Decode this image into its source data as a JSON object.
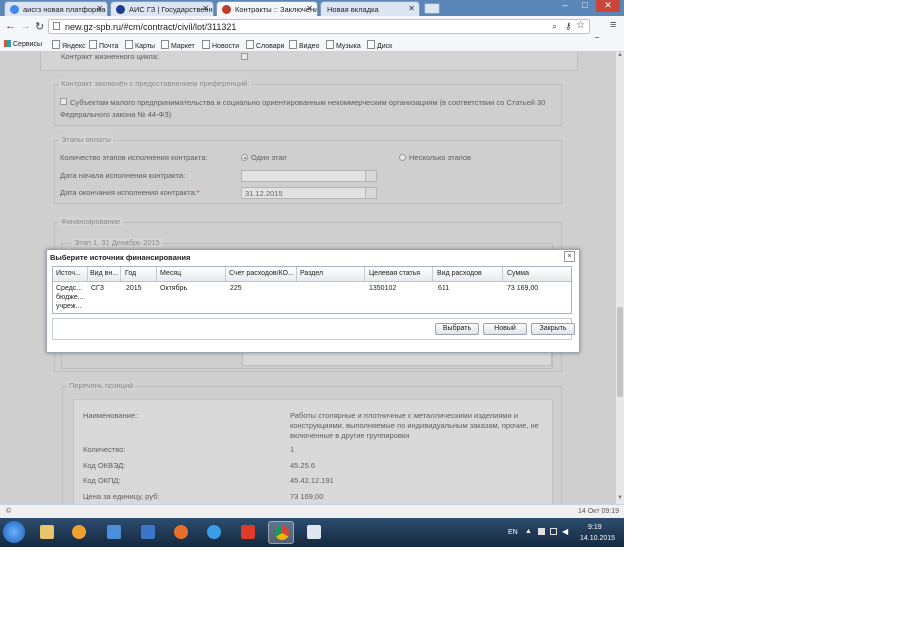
{
  "browser": {
    "tabs": [
      {
        "label": "аисгз новая платформа",
        "color": "#4285f4"
      },
      {
        "label": "АИС ГЗ | Государственн",
        "color": "#1c3c8c"
      },
      {
        "label": "Контракты :: Заключени",
        "color": "#c0392b"
      },
      {
        "label": "Новая вкладка",
        "color": "#cccccc"
      }
    ],
    "url": "new.gz-spb.ru/#cm/contract/civil/lot/311321",
    "bookmarks": [
      "Сервисы",
      "Яндекс",
      "Почта",
      "Карты",
      "Маркет",
      "Новости",
      "Словари",
      "Видео",
      "Музыка",
      "Диск"
    ],
    "status_left": "©",
    "status_right": "14 Окт 09:19"
  },
  "form": {
    "lifecycle_label": "Контракт жизненного цикла:",
    "preferences": {
      "legend": "Контракт заключён с предоставлением преференций:",
      "checkbox_line1": "Субъектам малого предпринимательства и социально ориентированным некоммерческим организациям (в соответствии со Статьей 30",
      "checkbox_line2": "Федерального закона № 44-ФЗ)"
    },
    "payment": {
      "legend": "Этапы оплаты",
      "stages_label": "Количество этапов исполнения контракта:",
      "option_one": "Один этап",
      "option_many": "Несколько этапов",
      "start_label": "Дата начала исполнения контракта:",
      "end_label": "Дата окончания исполнения контракта:",
      "required_mark": "*",
      "end_value": "31.12.2015"
    },
    "financing": {
      "legend": "Финансирование",
      "stage_legend": "Этап 1. 31 Декабрь 2015"
    },
    "positions": {
      "legend": "Перечень позиций",
      "name_label": "Наименование:",
      "name_line1": "Работы столярные и плотничные с металлическими изделиями и",
      "name_line2": "конструкциями, выполняемые по индивидуальным заказам, прочие, не",
      "name_line3": "включенные в другие группировки",
      "qty_label": "Количество:",
      "qty_value": "1",
      "okved_label": "Код ОКВЭД:",
      "okved_value": "45.25.6",
      "okpd_label": "Код ОКПД:",
      "okpd_value": "45.42.12.191",
      "price_label": "Цена за единицу, руб:",
      "price_value": "73 169,00"
    }
  },
  "modal": {
    "title": "Выберите источник финансирования",
    "close": "×",
    "columns": [
      "Источ...",
      "Вид вн...",
      "Год",
      "Месяц",
      "Счет расходов/КО...",
      "Раздел",
      "Целевая статья",
      "Вид расходов",
      "Сумма"
    ],
    "row": {
      "source_line1": "Средс...",
      "source_line2": "бюдже...",
      "source_line3": "учреж...",
      "type": "СГЗ",
      "year": "2015",
      "month": "Октябрь",
      "account": "225",
      "section": "",
      "target": "1350102",
      "expense_type": "611",
      "sum": "73 169,00"
    },
    "buttons": {
      "select": "Выбрать",
      "new": "Новый",
      "close": "Закрыть"
    }
  },
  "taskbar": {
    "lang": "EN",
    "time": "9:19",
    "date": "14.10.2015"
  }
}
